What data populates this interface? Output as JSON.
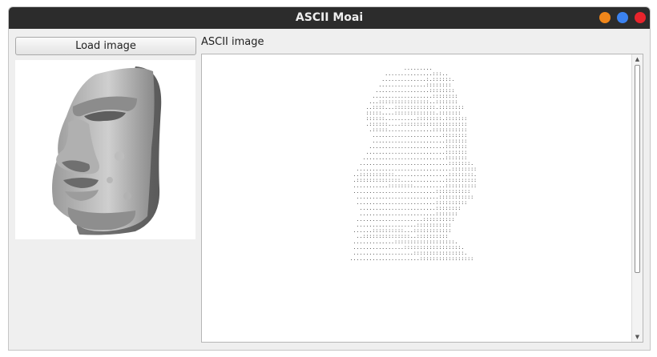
{
  "window": {
    "title": "ASCII Moai",
    "buttons": [
      {
        "name": "minimize",
        "color": "#f0861a"
      },
      {
        "name": "maximize",
        "color": "#3b82f0"
      },
      {
        "name": "close",
        "color": "#e8242c"
      }
    ]
  },
  "controls": {
    "load_button": "Load image"
  },
  "preview": {
    "icon": "moai-icon"
  },
  "ascii_section": {
    "label": "ASCII image",
    "art": "                    .........                   \n              ...............:::..              \n             ..............:.::::::.            \n            ...............::::::::             \n           .................::::::::            \n          ...................::::::::           \n         ...::::::::::::::::..:::::::           \n        ..::::...:::::::::::::.::::::::         \n        :::::....:::::::::::::.:::::::          \n        ::::::..........::::::::.:::::::        \n        .::::::....:::::::::::::::::::::        \n         .:::::..............:::::::::::        \n          ......................::::::::        \n          .......................:::::::        \n         ........................:::::::        \n        .........................:::::::        \n       ..........................:::::::        \n      ............................:::::::.      \n     ..............................::::::::     \n    ..:::::::::::.................::::::::.     \n    .::::::::::::::..............::::::::::     \n    ...........::::::::..........::::::::::     \n    ..........................:::::::::::       \n     ..........................:::::::::::      \n     .........................::::::::::        \n      ........................::::::::          \n      ........................:::::::           \n     .....................::::::::::            \n     ...................:::::::::::             \n    ......::::::::::...::::::::::::             \n     ..:::::::::::::::..::::::::::              \n    .............:::::::::::::::::::.           \n    ................::::::::::::::::::.         \n    ...................::::::::::::::::.        \n   ......................:::::::::::::::::      "
  }
}
